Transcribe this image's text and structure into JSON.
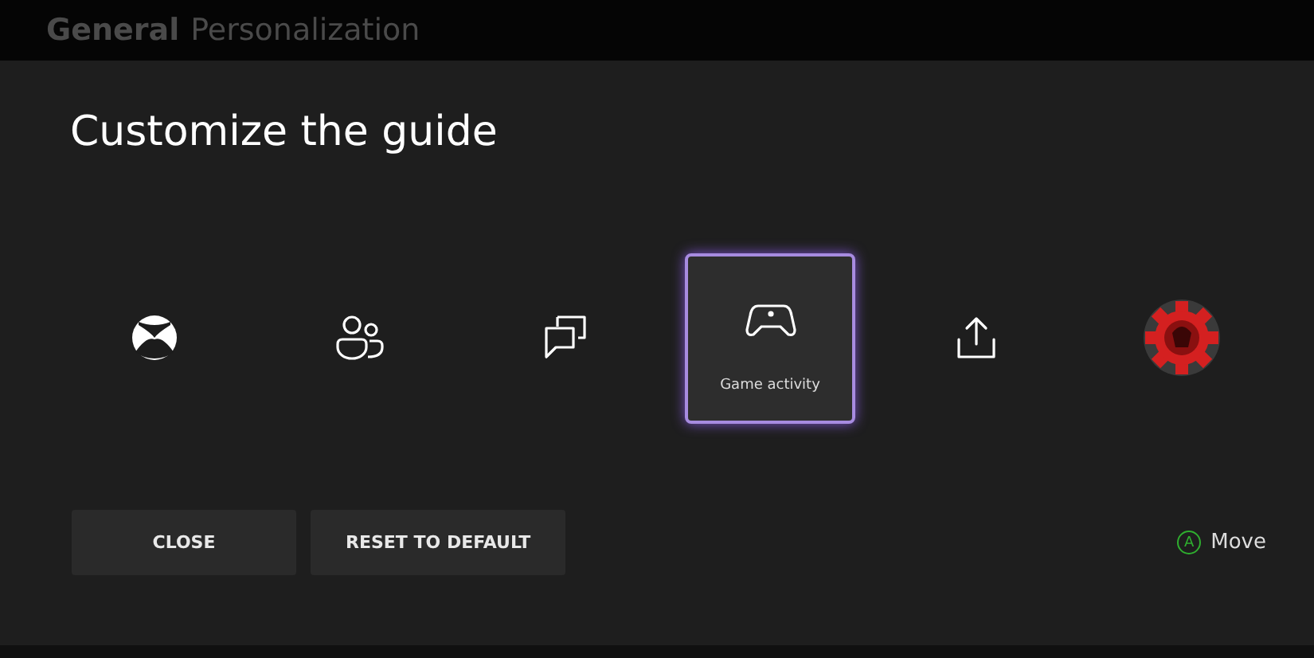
{
  "header": {
    "tabs": [
      {
        "label": "General",
        "selected": true
      },
      {
        "label": "Personalization",
        "selected": false
      }
    ]
  },
  "title": "Customize the guide",
  "slots": [
    {
      "kind": "xbox",
      "selected": false
    },
    {
      "kind": "people",
      "selected": false
    },
    {
      "kind": "chat",
      "selected": false
    },
    {
      "kind": "controller",
      "selected": true,
      "label": "Game activity"
    },
    {
      "kind": "share",
      "selected": false
    },
    {
      "kind": "avatar",
      "selected": false
    }
  ],
  "buttons": [
    "CLOSE",
    "RESET TO DEFAULT"
  ],
  "hint": {
    "key": "A",
    "label": "Move"
  }
}
